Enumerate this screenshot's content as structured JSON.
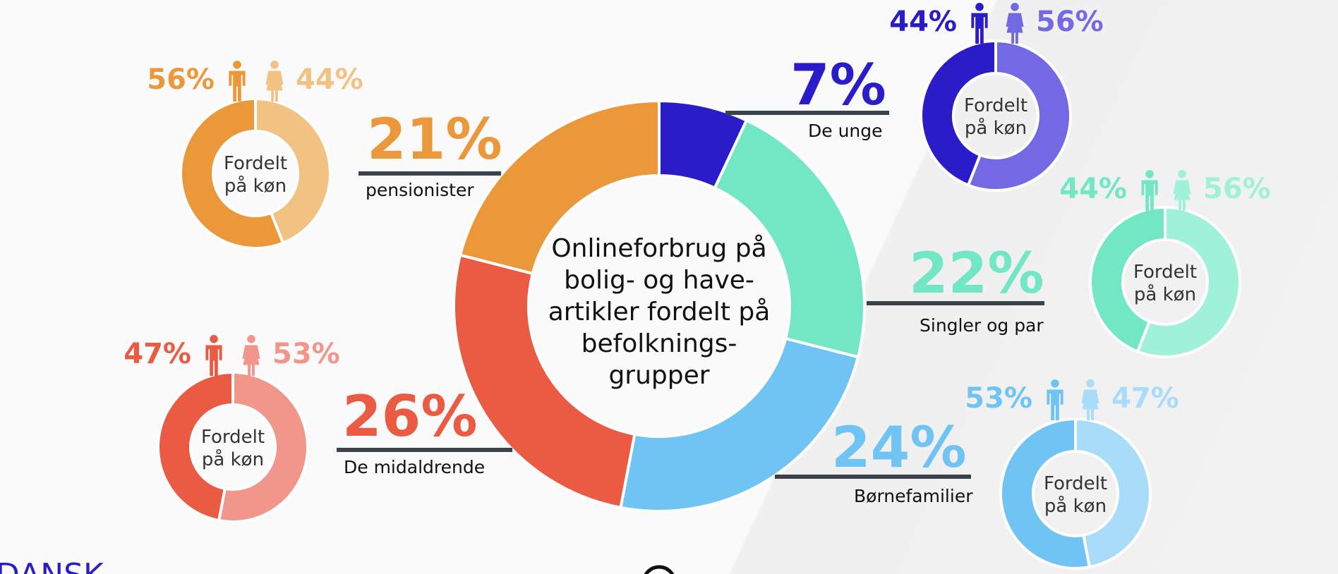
{
  "chart_data": {
    "type": "pie",
    "variant": "donut",
    "title": "Onlineforbrug på bolig- og have-artikler fordelt på befolknings-grupper",
    "title_lines": [
      "Onlineforbrug på",
      "bolig- og have-",
      "artikler fordelt på",
      "befolknings-",
      "grupper"
    ],
    "unit": "%",
    "slices": [
      {
        "label": "De unge",
        "value": 7,
        "value_text": "7%",
        "color": "#2a1cc9",
        "gender": {
          "caption_lines": [
            "Fordelt",
            "på køn"
          ],
          "male": 44,
          "female": 56,
          "male_text": "44%",
          "female_text": "56%",
          "male_color": "#2a1cc9",
          "female_color": "#7469e4"
        }
      },
      {
        "label": "Singler og par",
        "value": 22,
        "value_text": "22%",
        "color": "#72e7c4",
        "gender": {
          "caption_lines": [
            "Fordelt",
            "på køn"
          ],
          "male": 44,
          "female": 56,
          "male_text": "44%",
          "female_text": "56%",
          "male_color": "#72e7c4",
          "female_color": "#9ff1d8"
        }
      },
      {
        "label": "Børnefamilier",
        "value": 24,
        "value_text": "24%",
        "color": "#6fc4f4",
        "gender": {
          "caption_lines": [
            "Fordelt",
            "på køn"
          ],
          "male": 53,
          "female": 47,
          "male_text": "53%",
          "female_text": "47%",
          "male_color": "#6fc4f4",
          "female_color": "#a8dcf8"
        }
      },
      {
        "label": "De midaldrende",
        "value": 26,
        "value_text": "26%",
        "color": "#eb5a43",
        "gender": {
          "caption_lines": [
            "Fordelt",
            "på køn"
          ],
          "male": 47,
          "female": 53,
          "male_text": "47%",
          "female_text": "53%",
          "male_color": "#eb5a43",
          "female_color": "#f1968a"
        }
      },
      {
        "label": "pensionister",
        "value": 21,
        "value_text": "21%",
        "color": "#eb983b",
        "gender": {
          "caption_lines": [
            "Fordelt",
            "på køn"
          ],
          "male": 56,
          "female": 44,
          "male_text": "56%",
          "female_text": "44%",
          "male_color": "#eb983b",
          "female_color": "#f2c282"
        }
      }
    ]
  },
  "footer": {
    "logo_text": "DANSK"
  },
  "colors": {
    "rule": "#3a434b",
    "text": "#111111",
    "logo": "#2a1cc9"
  },
  "icons": [
    "male-person-icon",
    "female-person-icon"
  ]
}
